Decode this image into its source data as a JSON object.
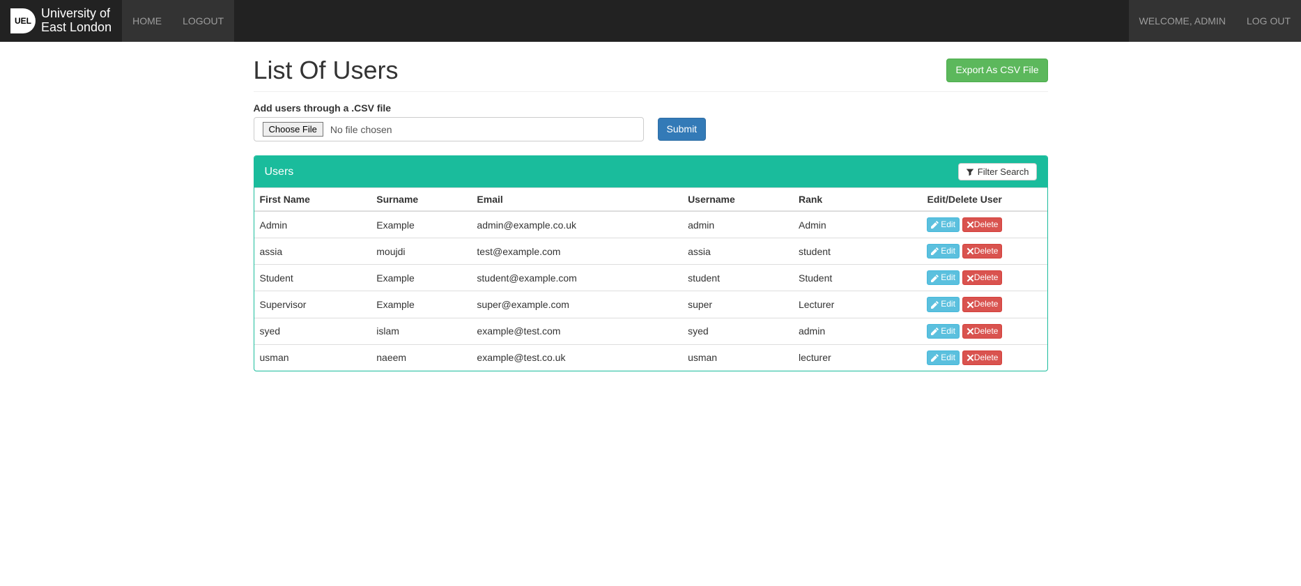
{
  "navbar": {
    "brand_line1": "University of",
    "brand_line2": "East London",
    "brand_code": "UEL",
    "links": [
      {
        "label": "HOME"
      },
      {
        "label": "LOGOUT"
      }
    ],
    "right": [
      {
        "label": "WELCOME, ADMIN"
      },
      {
        "label": "LOG OUT"
      }
    ]
  },
  "page": {
    "title": "List Of Users",
    "export_label": "Export As CSV File"
  },
  "upload": {
    "label": "Add users through a .CSV file",
    "choose_file_label": "Choose File",
    "placeholder": "No file chosen",
    "submit_label": "Submit"
  },
  "panel": {
    "title": "Users",
    "filter_label": "Filter Search"
  },
  "table": {
    "headers": {
      "first_name": "First Name",
      "surname": "Surname",
      "email": "Email",
      "username": "Username",
      "rank": "Rank",
      "actions": "Edit/Delete User"
    },
    "edit_label": "Edit",
    "delete_label": "Delete",
    "rows": [
      {
        "first_name": "Admin",
        "surname": "Example",
        "email": "admin@example.co.uk",
        "username": "admin",
        "rank": "Admin"
      },
      {
        "first_name": "assia",
        "surname": "moujdi",
        "email": "test@example.com",
        "username": "assia",
        "rank": "student"
      },
      {
        "first_name": "Student",
        "surname": "Example",
        "email": "student@example.com",
        "username": "student",
        "rank": "Student"
      },
      {
        "first_name": "Supervisor",
        "surname": "Example",
        "email": "super@example.com",
        "username": "super",
        "rank": "Lecturer"
      },
      {
        "first_name": "syed",
        "surname": "islam",
        "email": "example@test.com",
        "username": "syed",
        "rank": "admin"
      },
      {
        "first_name": "usman",
        "surname": "naeem",
        "email": "example@test.co.uk",
        "username": "usman",
        "rank": "lecturer"
      }
    ]
  }
}
